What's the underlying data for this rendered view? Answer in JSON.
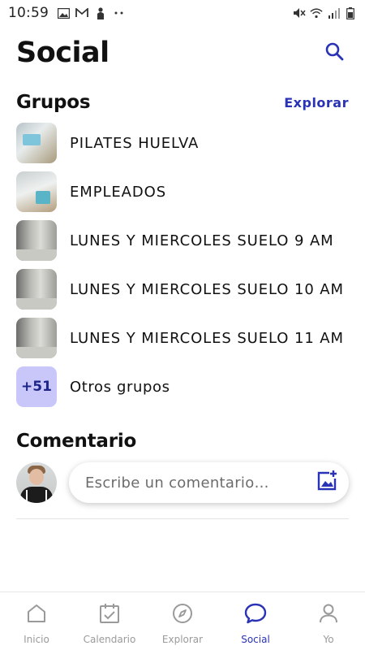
{
  "status_bar": {
    "time": "10:59",
    "left_icons": [
      "image-icon",
      "gmail-icon",
      "silhouette-icon",
      "more-dots-icon"
    ],
    "right_icons": [
      "mute-icon",
      "wifi-icon",
      "signal-icon",
      "battery-icon"
    ]
  },
  "header": {
    "title": "Social",
    "search_icon": "search-icon"
  },
  "groups": {
    "title": "Grupos",
    "explore_label": "Explorar",
    "items": [
      {
        "label": "PILATES HUELVA"
      },
      {
        "label": "EMPLEADOS"
      },
      {
        "label": "LUNES Y MIERCOLES SUELO 9 AM"
      },
      {
        "label": "LUNES Y MIERCOLES SUELO 10 AM"
      },
      {
        "label": "LUNES Y MIERCOLES SUELO 11 AM"
      }
    ],
    "others": {
      "count_label": "+51",
      "label": "Otros grupos"
    }
  },
  "comment": {
    "title": "Comentario",
    "placeholder": "Escribe un comentario…",
    "add_image_icon": "add-photo-icon"
  },
  "bottom_nav": {
    "items": [
      {
        "label": "Inicio",
        "icon": "home-icon",
        "active": false
      },
      {
        "label": "Calendario",
        "icon": "calendar-check-icon",
        "active": false
      },
      {
        "label": "Explorar",
        "icon": "compass-icon",
        "active": false
      },
      {
        "label": "Social",
        "icon": "chat-bubble-icon",
        "active": true
      },
      {
        "label": "Yo",
        "icon": "person-icon",
        "active": false
      }
    ]
  },
  "colors": {
    "accent": "#2a33b5",
    "badge_bg": "#c9c7fa",
    "inactive": "#9a9a9a"
  }
}
